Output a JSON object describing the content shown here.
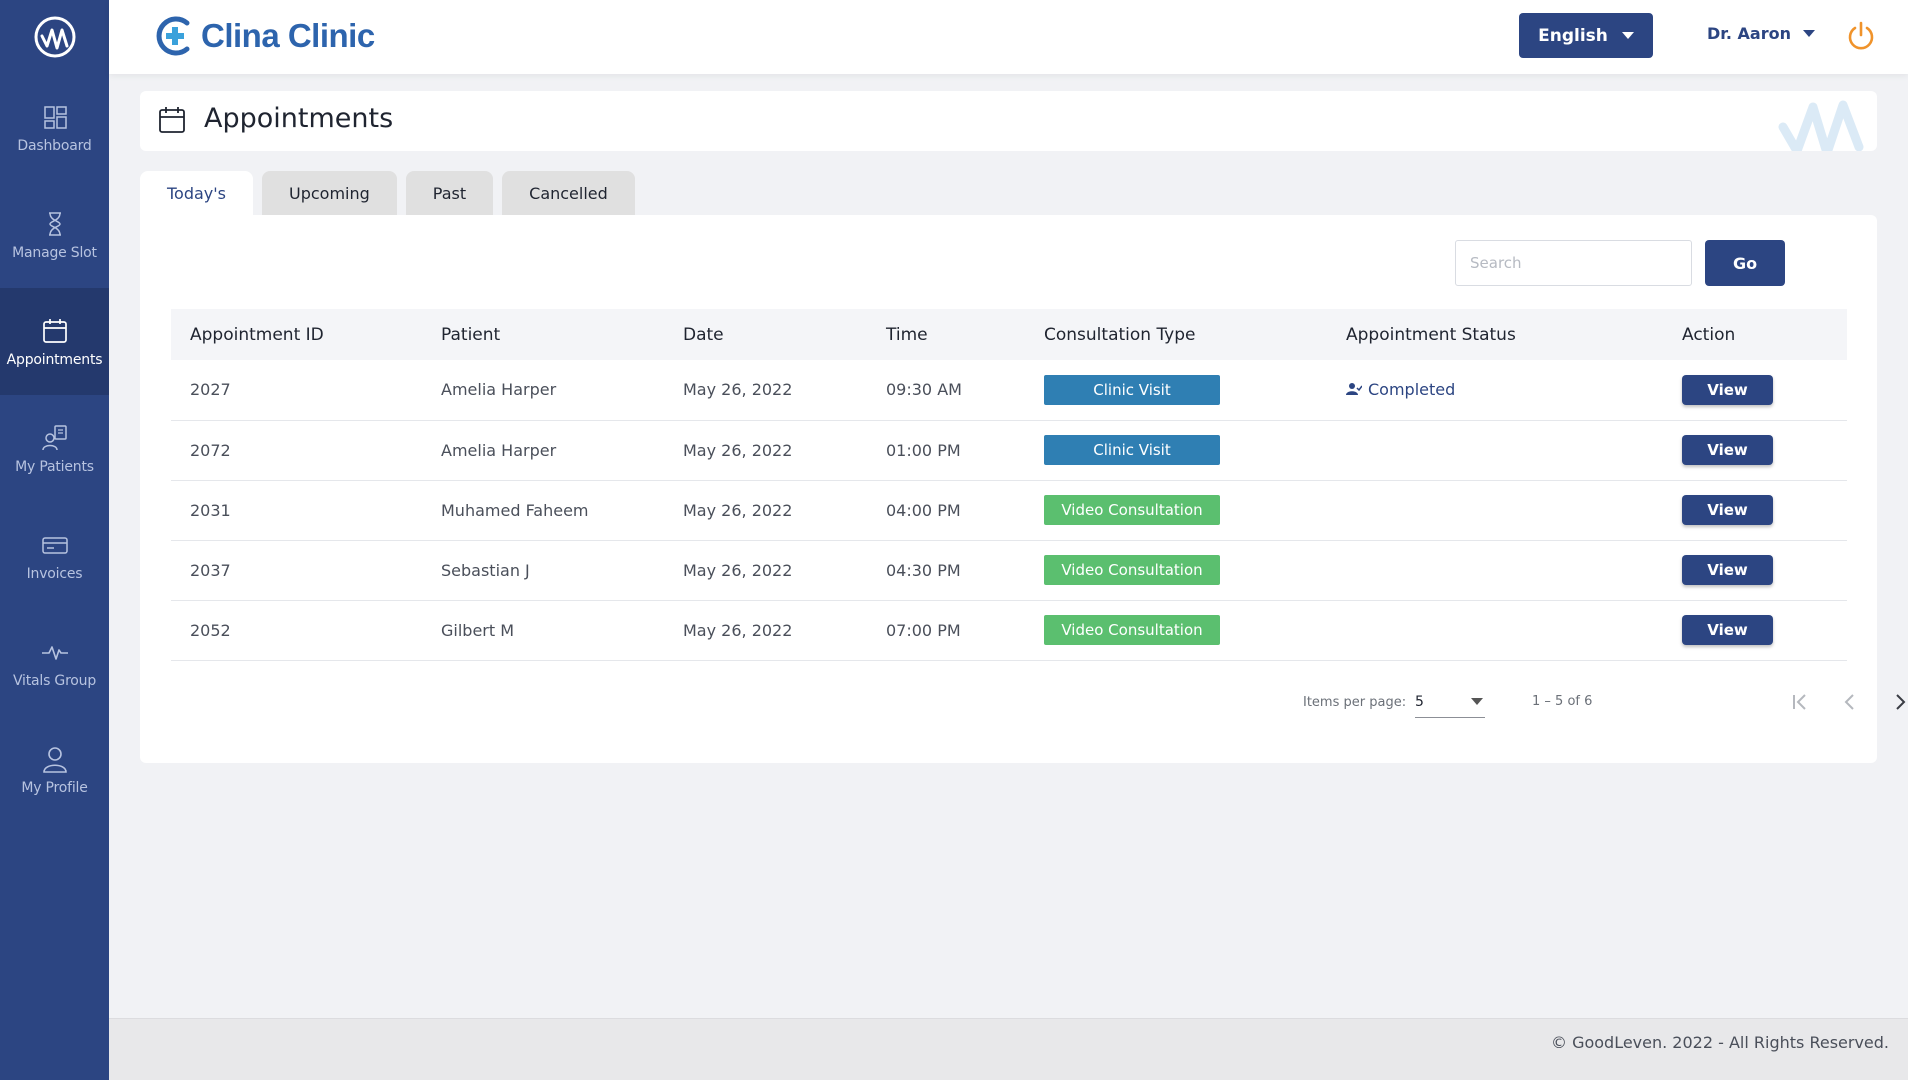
{
  "app": {
    "brand": "Clina Clinic"
  },
  "sidebar": {
    "items": [
      {
        "label": "Dashboard",
        "icon": "dashboard-icon",
        "active": false
      },
      {
        "label": "Manage Slot",
        "icon": "hourglass-icon",
        "active": false
      },
      {
        "label": "Appointments",
        "icon": "calendar-icon",
        "active": true
      },
      {
        "label": "My Patients",
        "icon": "patients-icon",
        "active": false
      },
      {
        "label": "Invoices",
        "icon": "card-icon",
        "active": false
      },
      {
        "label": "Vitals Group",
        "icon": "pulse-icon",
        "active": false
      },
      {
        "label": "My Profile",
        "icon": "user-icon",
        "active": false
      }
    ]
  },
  "header": {
    "language": "English",
    "user": "Dr. Aaron"
  },
  "page": {
    "title": "Appointments"
  },
  "tabs": [
    {
      "label": "Today's",
      "active": true
    },
    {
      "label": "Upcoming",
      "active": false
    },
    {
      "label": "Past",
      "active": false
    },
    {
      "label": "Cancelled",
      "active": false
    }
  ],
  "search": {
    "placeholder": "Search",
    "value": "",
    "button": "Go"
  },
  "table": {
    "columns": [
      "Appointment ID",
      "Patient",
      "Date",
      "Time",
      "Consultation Type",
      "Appointment Status",
      "Action"
    ],
    "rows": [
      {
        "id": "2027",
        "patient": "Amelia Harper",
        "date": "May 26, 2022",
        "time": "09:30 AM",
        "type": "Clinic Visit",
        "type_kind": "clinic",
        "status": "Completed",
        "action": "View"
      },
      {
        "id": "2072",
        "patient": "Amelia Harper",
        "date": "May 26, 2022",
        "time": "01:00 PM",
        "type": "Clinic Visit",
        "type_kind": "clinic",
        "status": "",
        "action": "View"
      },
      {
        "id": "2031",
        "patient": "Muhamed Faheem",
        "date": "May 26, 2022",
        "time": "04:00 PM",
        "type": "Video Consultation",
        "type_kind": "video",
        "status": "",
        "action": "View"
      },
      {
        "id": "2037",
        "patient": "Sebastian J",
        "date": "May 26, 2022",
        "time": "04:30 PM",
        "type": "Video Consultation",
        "type_kind": "video",
        "status": "",
        "action": "View"
      },
      {
        "id": "2052",
        "patient": "Gilbert M",
        "date": "May 26, 2022",
        "time": "07:00 PM",
        "type": "Video Consultation",
        "type_kind": "video",
        "status": "",
        "action": "View"
      }
    ]
  },
  "pagination": {
    "items_per_page_label": "Items per page:",
    "items_per_page": "5",
    "range": "1 – 5 of 6"
  },
  "footer": {
    "copyright": "© GoodLeven. 2022 - All Rights Reserved."
  },
  "colors": {
    "primary": "#2c4582",
    "clinic_visit": "#2f7fb3",
    "video_consultation": "#5bbf6f",
    "power": "#f0932b"
  }
}
